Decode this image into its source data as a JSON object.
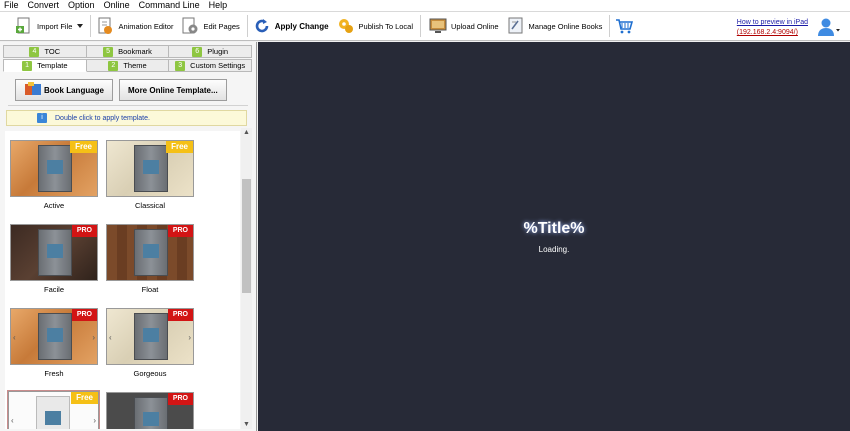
{
  "menu": [
    "File",
    "Convert",
    "Option",
    "Online",
    "Command Line",
    "Help"
  ],
  "toolbar": {
    "import_file": "Import File",
    "animation_editor": "Animation Editor",
    "edit_pages": "Edit Pages",
    "apply_change": "Apply Change",
    "publish_to_local": "Publish To Local",
    "upload_online": "Upload Online",
    "manage_online_books": "Manage Online Books",
    "ipad_link_line1": "How to preview in iPad",
    "ipad_link_line2": "(192.168.2.4:9094/)"
  },
  "tabs_top": [
    {
      "num": "4",
      "label": "TOC"
    },
    {
      "num": "5",
      "label": "Bookmark"
    },
    {
      "num": "6",
      "label": "Plugin"
    }
  ],
  "tabs_bottom": [
    {
      "num": "1",
      "label": "Template"
    },
    {
      "num": "2",
      "label": "Theme"
    },
    {
      "num": "3",
      "label": "Custom Settings"
    }
  ],
  "buttons": {
    "book_language": "Book Language",
    "more_templates": "More Online Template..."
  },
  "hint": "Double click to apply template.",
  "templates": [
    {
      "name": "Active",
      "badge": "Free"
    },
    {
      "name": "Classical",
      "badge": "Free"
    },
    {
      "name": "Facile",
      "badge": "PRO"
    },
    {
      "name": "Float",
      "badge": "PRO"
    },
    {
      "name": "Fresh",
      "badge": "PRO"
    },
    {
      "name": "Gorgeous",
      "badge": "PRO"
    },
    {
      "name": "",
      "badge": "Free"
    },
    {
      "name": "",
      "badge": "PRO"
    }
  ],
  "preview": {
    "title": "%Title%",
    "loading": "Loading."
  },
  "colors": {
    "preview_bg": "#272a37",
    "tab_number": "#8ec641",
    "free_badge": "#f5c016",
    "pro_badge": "#d21414"
  }
}
